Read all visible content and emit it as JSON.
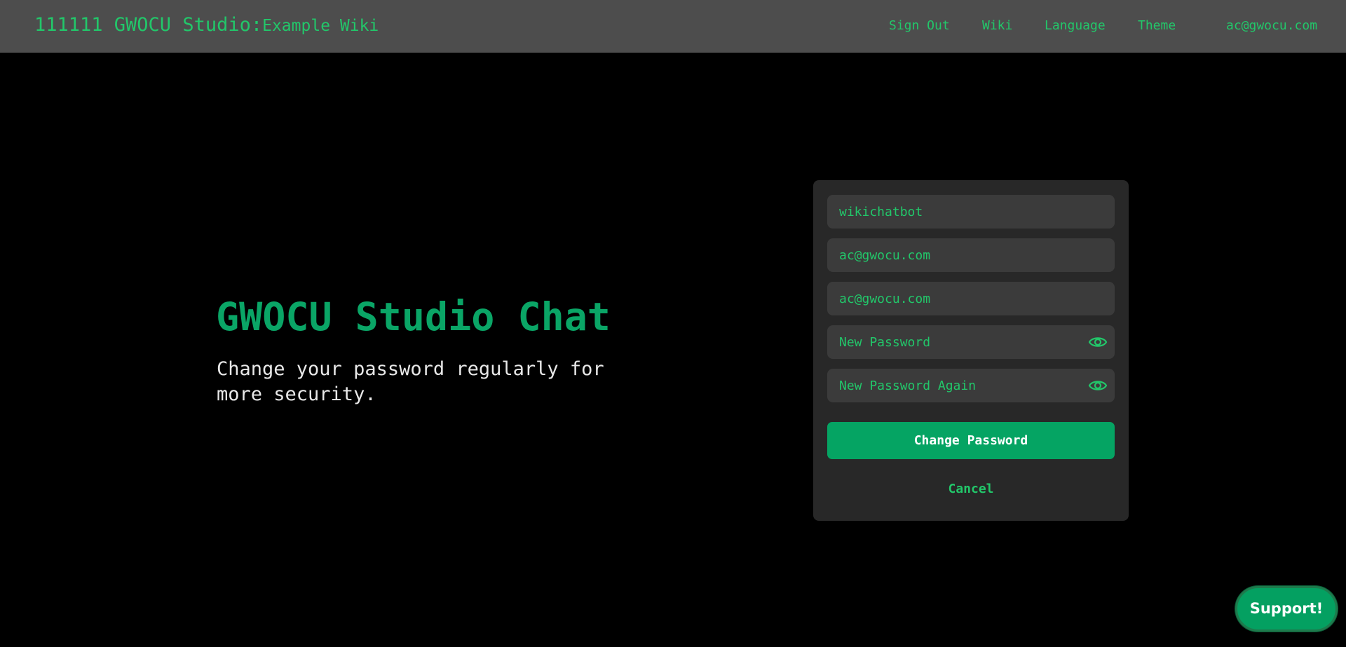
{
  "header": {
    "app_title": "111111 GWOCU Studio:",
    "wiki_name": "Example Wiki",
    "nav": {
      "sign_out": "Sign Out",
      "wiki": "Wiki",
      "language": "Language",
      "theme": "Theme",
      "user_email": "ac@gwocu.com"
    }
  },
  "hero": {
    "title": "GWOCU Studio Chat",
    "subtitle": "Change your password regularly for more security."
  },
  "form": {
    "username_value": "wikichatbot",
    "email_value": "ac@gwocu.com",
    "email_confirm_value": "ac@gwocu.com",
    "new_password_placeholder": "New Password",
    "new_password_again_placeholder": "New Password Again",
    "submit_label": "Change Password",
    "cancel_label": "Cancel",
    "eye_icon": "eye-icon"
  },
  "support": {
    "label": "Support!"
  },
  "colors": {
    "accent": "#22c76a",
    "primary_button": "#05a463",
    "header_bg": "#4d4d4d",
    "card_bg": "#282828",
    "field_bg": "#3b3b3b"
  }
}
